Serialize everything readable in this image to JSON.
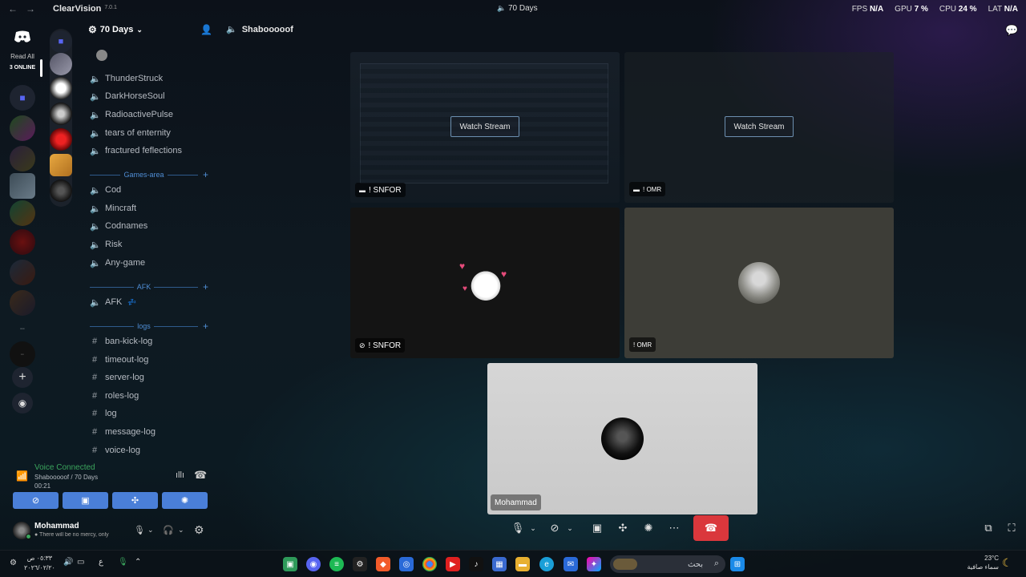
{
  "titlebar": {
    "app_name": "ClearVision",
    "app_version": "7.0.1",
    "center_title": "70 Days",
    "fps_label": "FPS",
    "fps_value": "N/A",
    "gpu_label": "GPU",
    "gpu_value": "7 %",
    "cpu_label": "CPU",
    "cpu_value": "24 %",
    "lat_label": "LAT",
    "lat_value": "N/A"
  },
  "guilds": {
    "read_all": "Read All",
    "online": "3 ONLINE"
  },
  "server": {
    "name": "70 Days",
    "voice_channels": [
      "ThunderStruck",
      "DarkHorseSoul",
      "RadioactivePulse",
      "tears of enternity",
      "fractured feflections"
    ],
    "categories": {
      "games": "Games-area",
      "afk": "AFK",
      "logs": "logs"
    },
    "games_channels": [
      "Cod",
      "Mincraft",
      "Codnames",
      "Risk",
      "Any-game"
    ],
    "afk_channel": "AFK",
    "afk_emoji": "💤",
    "log_channels": [
      "ban-kick-log",
      "timeout-log",
      "server-log",
      "roles-log",
      "log",
      "message-log",
      "voice-log"
    ]
  },
  "voice": {
    "status": "Voice Connected",
    "location": "Shabooooof / 70 Days",
    "timer": "00:21"
  },
  "user": {
    "name": "Mohammad",
    "status": "There will be no mercy, only"
  },
  "call": {
    "channel_name": "Shabooooof",
    "watch_stream_label": "Watch Stream",
    "tiles": [
      {
        "name": "! SNFOR"
      },
      {
        "name": "! OMR"
      },
      {
        "name": "! SNFOR"
      },
      {
        "name": "! OMR"
      },
      {
        "name": "Mohammad"
      }
    ]
  },
  "taskbar": {
    "time": "٠٥:٣٣ ص",
    "date": "٢٠٢٦/٠٢/٢٠",
    "lang": "ع",
    "search_placeholder": "بحث",
    "weather_temp": "23°C",
    "weather_desc": "سماء صافية"
  },
  "colors": {
    "accent": "#4a7fd8",
    "voice_green": "#3ba55d",
    "end_call": "#da373c"
  }
}
